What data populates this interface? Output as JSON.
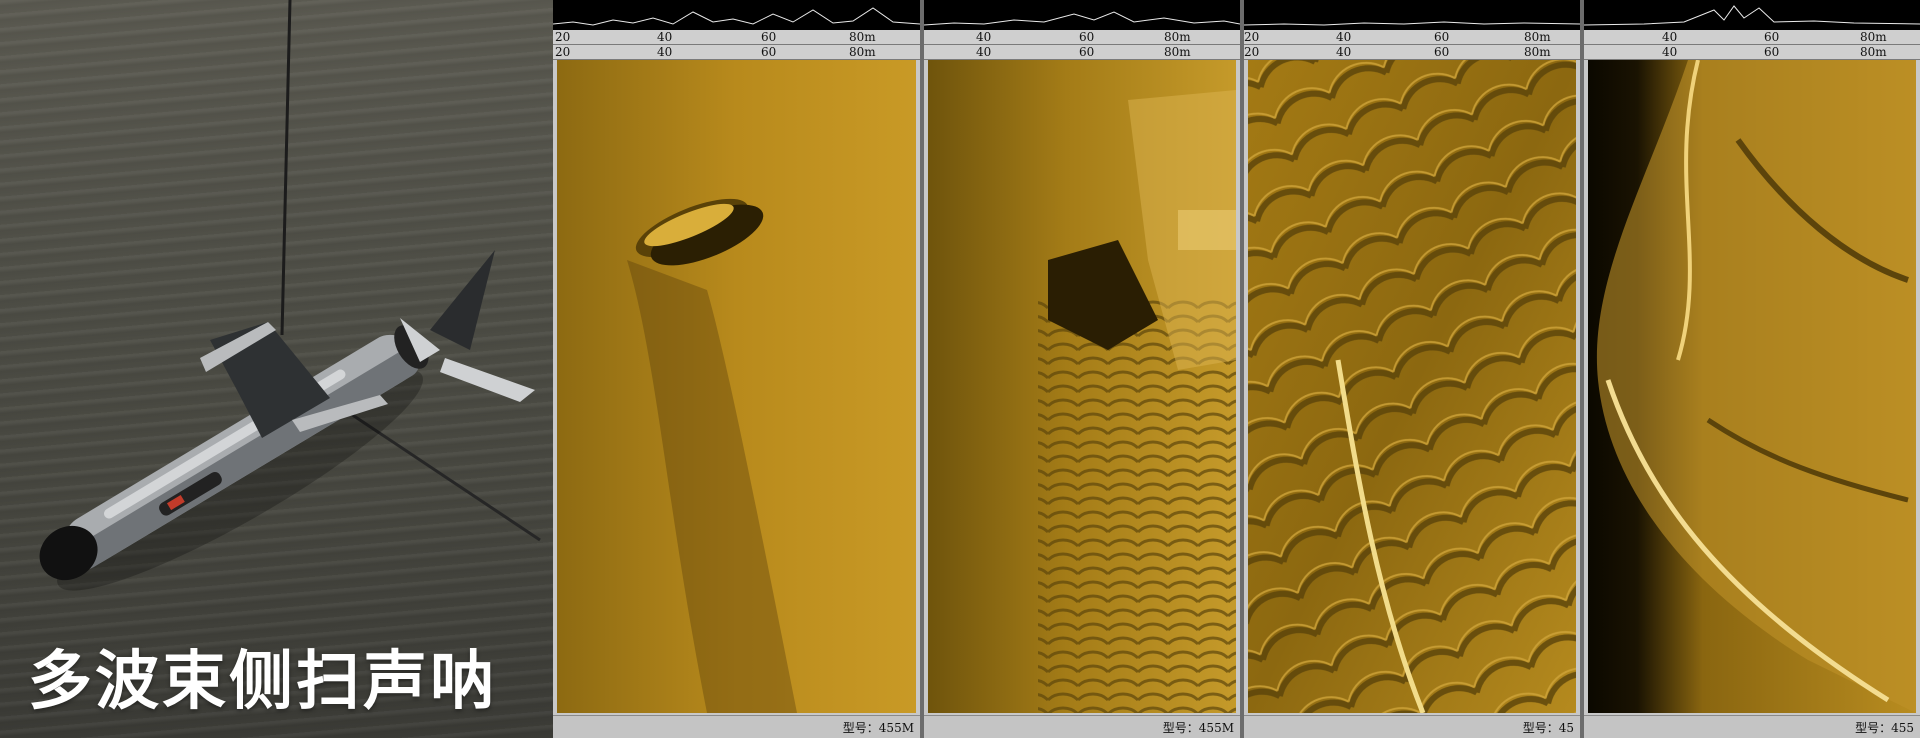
{
  "photo": {
    "title": "多波束侧扫声呐",
    "icon": "sonar-towfish-icon"
  },
  "panels": [
    {
      "scale_top": [
        "20",
        "40",
        "60",
        "80m"
      ],
      "scale_bottom": [
        "20",
        "40",
        "60",
        "80m"
      ],
      "footer": "型号：455M",
      "content": "shipwreck"
    },
    {
      "scale_top": [
        "40",
        "60",
        "80m"
      ],
      "scale_bottom": [
        "40",
        "60",
        "80m"
      ],
      "footer": "型号：455M",
      "content": "rocks-and-ripples"
    },
    {
      "scale_top": [
        "20",
        "40",
        "60",
        "80m"
      ],
      "scale_bottom": [
        "20",
        "40",
        "60",
        "80m"
      ],
      "footer": "型号：45",
      "content": "sand-dunes"
    },
    {
      "scale_top": [
        "40",
        "60",
        "80m"
      ],
      "scale_bottom": [
        "40",
        "60",
        "80m"
      ],
      "footer": "型号：455",
      "content": "rock-outcrop"
    }
  ],
  "colors": {
    "sonar_gold": "#b08418",
    "sonar_dark": "#3a2b05",
    "water": "#4e4e46",
    "scale_bar": "#cfcfcf"
  }
}
